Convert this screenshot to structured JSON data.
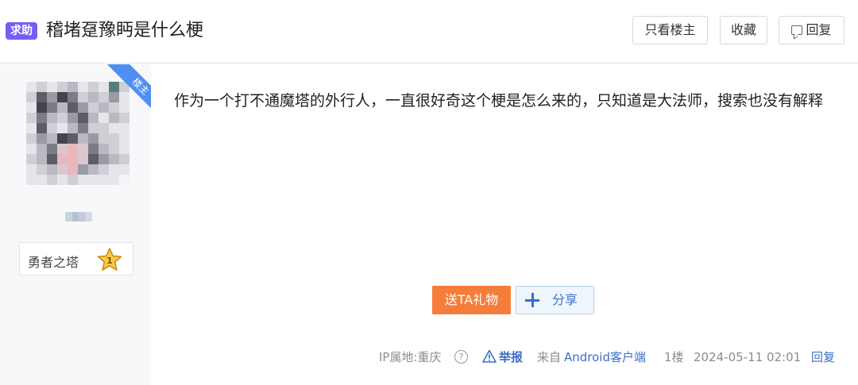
{
  "post": {
    "tag": "求助",
    "title": "稽堵趸豫眄是什么梗",
    "content": "作为一个打不通魔塔的外行人，一直很好奇这个梗是怎么来的，只知道是大法师，搜索也没有解释"
  },
  "header_actions": {
    "only_op": "只看楼主",
    "favorite": "收藏",
    "reply": "回复"
  },
  "author": {
    "corner_label": "楼主",
    "badge_forum": "勇者之塔",
    "level": "1"
  },
  "actions": {
    "gift": "送TA礼物",
    "share": "分享"
  },
  "footer": {
    "ip": "IP属地:重庆",
    "help_icon": "?",
    "report": "举报",
    "source_prefix": "来自",
    "source_client": "Android客户端",
    "floor": "1楼",
    "time": "2024-05-11 02:01",
    "reply": "回复"
  },
  "colors": {
    "tag_bg": "#7a5cf5",
    "corner_bg": "#4f8ef2",
    "gift_bg": "#f57d3a",
    "link_blue": "#3b6fc4",
    "side_bg": "#f7f8fa"
  },
  "icons": {
    "reply": "speech-bubble-icon",
    "report": "warning-triangle-icon",
    "share": "plus-icon",
    "level": "star-icon"
  }
}
